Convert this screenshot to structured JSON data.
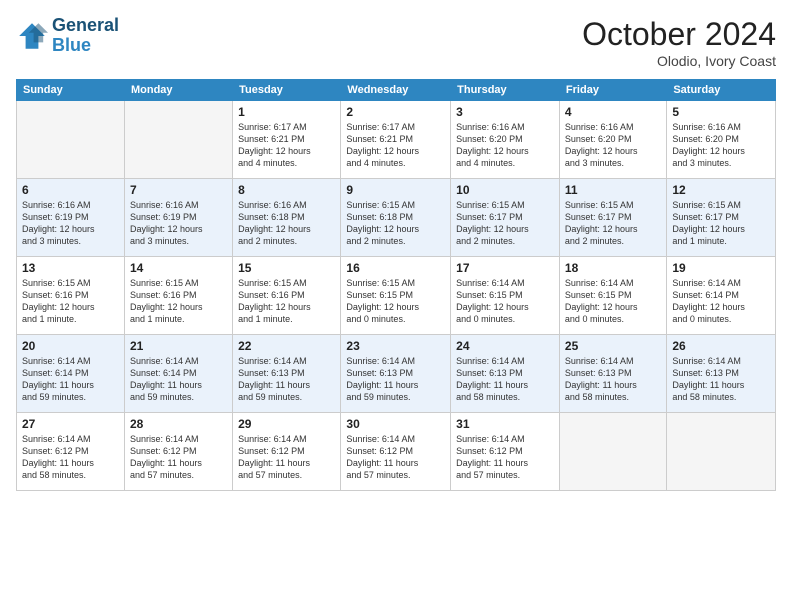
{
  "header": {
    "logo_line1": "General",
    "logo_line2": "Blue",
    "month": "October 2024",
    "location": "Olodio, Ivory Coast"
  },
  "weekdays": [
    "Sunday",
    "Monday",
    "Tuesday",
    "Wednesday",
    "Thursday",
    "Friday",
    "Saturday"
  ],
  "rows": [
    [
      {
        "day": "",
        "info": ""
      },
      {
        "day": "",
        "info": ""
      },
      {
        "day": "1",
        "info": "Sunrise: 6:17 AM\nSunset: 6:21 PM\nDaylight: 12 hours\nand 4 minutes."
      },
      {
        "day": "2",
        "info": "Sunrise: 6:17 AM\nSunset: 6:21 PM\nDaylight: 12 hours\nand 4 minutes."
      },
      {
        "day": "3",
        "info": "Sunrise: 6:16 AM\nSunset: 6:20 PM\nDaylight: 12 hours\nand 4 minutes."
      },
      {
        "day": "4",
        "info": "Sunrise: 6:16 AM\nSunset: 6:20 PM\nDaylight: 12 hours\nand 3 minutes."
      },
      {
        "day": "5",
        "info": "Sunrise: 6:16 AM\nSunset: 6:20 PM\nDaylight: 12 hours\nand 3 minutes."
      }
    ],
    [
      {
        "day": "6",
        "info": "Sunrise: 6:16 AM\nSunset: 6:19 PM\nDaylight: 12 hours\nand 3 minutes."
      },
      {
        "day": "7",
        "info": "Sunrise: 6:16 AM\nSunset: 6:19 PM\nDaylight: 12 hours\nand 3 minutes."
      },
      {
        "day": "8",
        "info": "Sunrise: 6:16 AM\nSunset: 6:18 PM\nDaylight: 12 hours\nand 2 minutes."
      },
      {
        "day": "9",
        "info": "Sunrise: 6:15 AM\nSunset: 6:18 PM\nDaylight: 12 hours\nand 2 minutes."
      },
      {
        "day": "10",
        "info": "Sunrise: 6:15 AM\nSunset: 6:17 PM\nDaylight: 12 hours\nand 2 minutes."
      },
      {
        "day": "11",
        "info": "Sunrise: 6:15 AM\nSunset: 6:17 PM\nDaylight: 12 hours\nand 2 minutes."
      },
      {
        "day": "12",
        "info": "Sunrise: 6:15 AM\nSunset: 6:17 PM\nDaylight: 12 hours\nand 1 minute."
      }
    ],
    [
      {
        "day": "13",
        "info": "Sunrise: 6:15 AM\nSunset: 6:16 PM\nDaylight: 12 hours\nand 1 minute."
      },
      {
        "day": "14",
        "info": "Sunrise: 6:15 AM\nSunset: 6:16 PM\nDaylight: 12 hours\nand 1 minute."
      },
      {
        "day": "15",
        "info": "Sunrise: 6:15 AM\nSunset: 6:16 PM\nDaylight: 12 hours\nand 1 minute."
      },
      {
        "day": "16",
        "info": "Sunrise: 6:15 AM\nSunset: 6:15 PM\nDaylight: 12 hours\nand 0 minutes."
      },
      {
        "day": "17",
        "info": "Sunrise: 6:14 AM\nSunset: 6:15 PM\nDaylight: 12 hours\nand 0 minutes."
      },
      {
        "day": "18",
        "info": "Sunrise: 6:14 AM\nSunset: 6:15 PM\nDaylight: 12 hours\nand 0 minutes."
      },
      {
        "day": "19",
        "info": "Sunrise: 6:14 AM\nSunset: 6:14 PM\nDaylight: 12 hours\nand 0 minutes."
      }
    ],
    [
      {
        "day": "20",
        "info": "Sunrise: 6:14 AM\nSunset: 6:14 PM\nDaylight: 11 hours\nand 59 minutes."
      },
      {
        "day": "21",
        "info": "Sunrise: 6:14 AM\nSunset: 6:14 PM\nDaylight: 11 hours\nand 59 minutes."
      },
      {
        "day": "22",
        "info": "Sunrise: 6:14 AM\nSunset: 6:13 PM\nDaylight: 11 hours\nand 59 minutes."
      },
      {
        "day": "23",
        "info": "Sunrise: 6:14 AM\nSunset: 6:13 PM\nDaylight: 11 hours\nand 59 minutes."
      },
      {
        "day": "24",
        "info": "Sunrise: 6:14 AM\nSunset: 6:13 PM\nDaylight: 11 hours\nand 58 minutes."
      },
      {
        "day": "25",
        "info": "Sunrise: 6:14 AM\nSunset: 6:13 PM\nDaylight: 11 hours\nand 58 minutes."
      },
      {
        "day": "26",
        "info": "Sunrise: 6:14 AM\nSunset: 6:13 PM\nDaylight: 11 hours\nand 58 minutes."
      }
    ],
    [
      {
        "day": "27",
        "info": "Sunrise: 6:14 AM\nSunset: 6:12 PM\nDaylight: 11 hours\nand 58 minutes."
      },
      {
        "day": "28",
        "info": "Sunrise: 6:14 AM\nSunset: 6:12 PM\nDaylight: 11 hours\nand 57 minutes."
      },
      {
        "day": "29",
        "info": "Sunrise: 6:14 AM\nSunset: 6:12 PM\nDaylight: 11 hours\nand 57 minutes."
      },
      {
        "day": "30",
        "info": "Sunrise: 6:14 AM\nSunset: 6:12 PM\nDaylight: 11 hours\nand 57 minutes."
      },
      {
        "day": "31",
        "info": "Sunrise: 6:14 AM\nSunset: 6:12 PM\nDaylight: 11 hours\nand 57 minutes."
      },
      {
        "day": "",
        "info": ""
      },
      {
        "day": "",
        "info": ""
      }
    ]
  ]
}
